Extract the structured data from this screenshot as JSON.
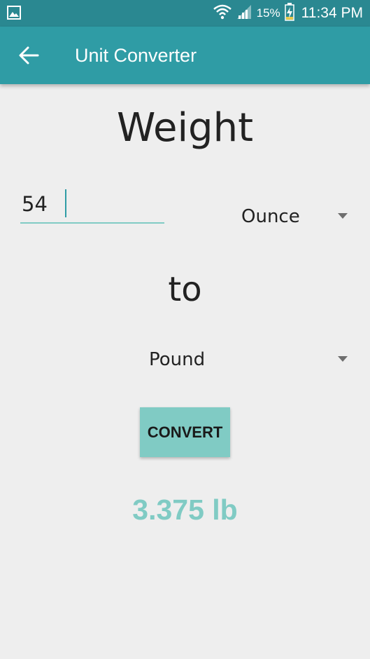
{
  "status_bar": {
    "battery_percent": "15%",
    "time": "11:34 PM",
    "icons": [
      "gallery-icon",
      "wifi-icon",
      "signal-icon",
      "battery-charging-icon"
    ]
  },
  "app_bar": {
    "title": "Unit Converter",
    "back_icon": "arrow-back-icon"
  },
  "main": {
    "heading": "Weight",
    "input_value": "54",
    "from_unit": "Ounce",
    "connector": "to",
    "to_unit": "Pound",
    "convert_label": "CONVERT",
    "result": "3.375 lb"
  },
  "colors": {
    "status_bar": "#2a8891",
    "app_bar": "#2f9ca5",
    "accent": "#80cbc4",
    "background": "#eeeeee"
  }
}
